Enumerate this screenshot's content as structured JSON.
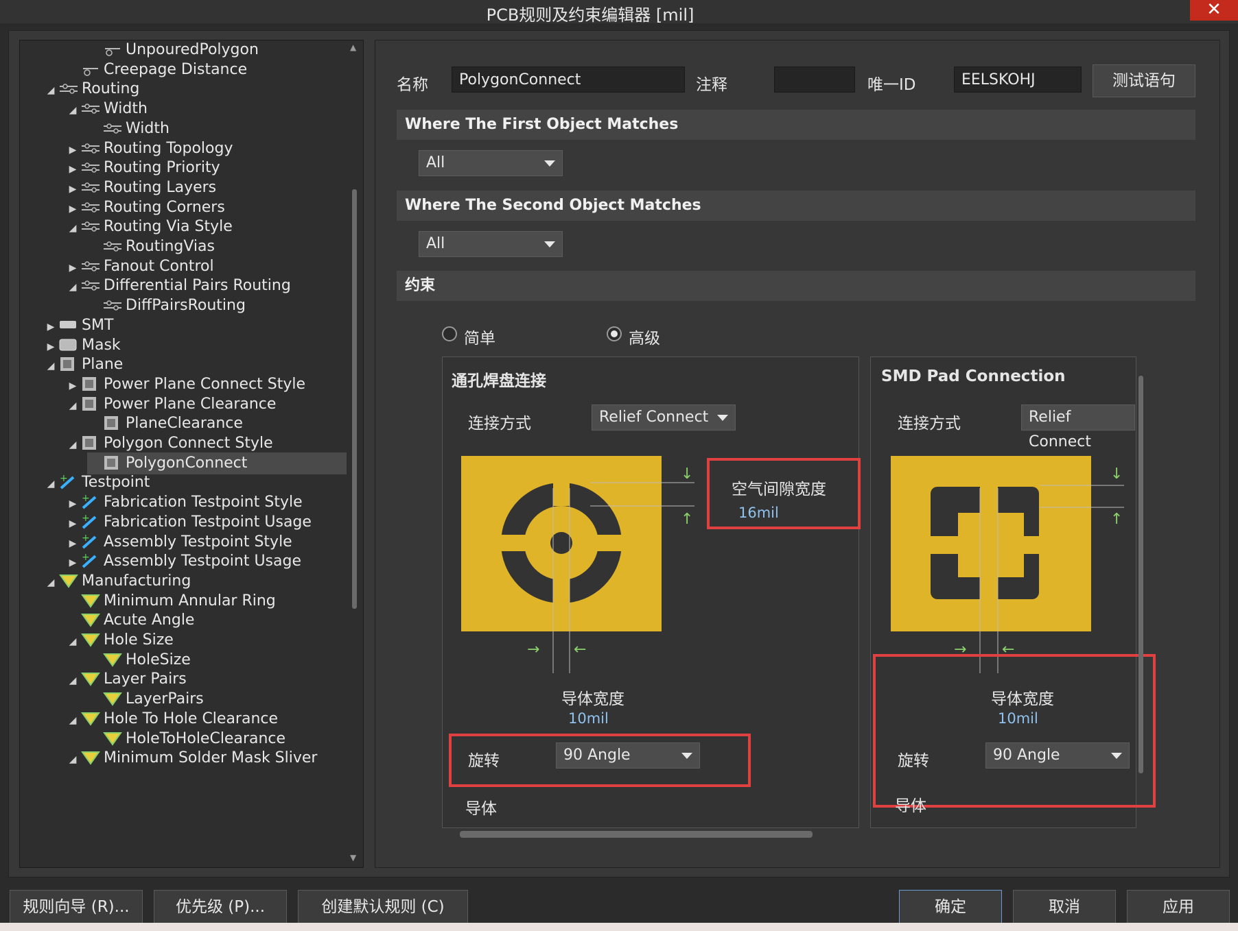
{
  "window": {
    "title": "PCB规则及约束编辑器 [mil]",
    "close_label": "✕"
  },
  "tree": {
    "items": [
      {
        "label": "UnpouredPolygon",
        "expander": ""
      },
      {
        "label": "Creepage Distance",
        "expander": ""
      },
      {
        "label": "Routing",
        "expander": "◢"
      },
      {
        "label": "Width",
        "expander": "◢"
      },
      {
        "label": "Width",
        "expander": ""
      },
      {
        "label": "Routing Topology",
        "expander": "▶"
      },
      {
        "label": "Routing Priority",
        "expander": "▶"
      },
      {
        "label": "Routing Layers",
        "expander": "▶"
      },
      {
        "label": "Routing Corners",
        "expander": "▶"
      },
      {
        "label": "Routing Via Style",
        "expander": "◢"
      },
      {
        "label": "RoutingVias",
        "expander": ""
      },
      {
        "label": "Fanout Control",
        "expander": "▶"
      },
      {
        "label": "Differential Pairs Routing",
        "expander": "◢"
      },
      {
        "label": "DiffPairsRouting",
        "expander": ""
      },
      {
        "label": "SMT",
        "expander": "▶"
      },
      {
        "label": "Mask",
        "expander": "▶"
      },
      {
        "label": "Plane",
        "expander": "◢"
      },
      {
        "label": "Power Plane Connect Style",
        "expander": "▶"
      },
      {
        "label": "Power Plane Clearance",
        "expander": "◢"
      },
      {
        "label": "PlaneClearance",
        "expander": ""
      },
      {
        "label": "Polygon Connect Style",
        "expander": "◢"
      },
      {
        "label": "PolygonConnect",
        "expander": ""
      },
      {
        "label": "Testpoint",
        "expander": "◢"
      },
      {
        "label": "Fabrication Testpoint Style",
        "expander": "▶"
      },
      {
        "label": "Fabrication Testpoint Usage",
        "expander": "▶"
      },
      {
        "label": "Assembly Testpoint Style",
        "expander": "▶"
      },
      {
        "label": "Assembly Testpoint Usage",
        "expander": "▶"
      },
      {
        "label": "Manufacturing",
        "expander": "◢"
      },
      {
        "label": "Minimum Annular Ring",
        "expander": ""
      },
      {
        "label": "Acute Angle",
        "expander": ""
      },
      {
        "label": "Hole Size",
        "expander": "◢"
      },
      {
        "label": "HoleSize",
        "expander": ""
      },
      {
        "label": "Layer Pairs",
        "expander": "◢"
      },
      {
        "label": "LayerPairs",
        "expander": ""
      },
      {
        "label": "Hole To Hole Clearance",
        "expander": "◢"
      },
      {
        "label": "HoleToHoleClearance",
        "expander": ""
      },
      {
        "label": "Minimum Solder Mask Sliver",
        "expander": "◢"
      }
    ]
  },
  "form": {
    "name_label": "名称",
    "name_value": "PolygonConnect",
    "comment_label": "注释",
    "comment_value": "",
    "uid_label": "唯一ID",
    "uid_value": "EELSKOHJ",
    "test_button": "测试语句",
    "first_match_header": "Where The First Object Matches",
    "first_match_value": "All",
    "second_match_header": "Where The Second Object Matches",
    "second_match_value": "All",
    "constraints_header": "约束",
    "radio_simple": "简单",
    "radio_advanced": "高级"
  },
  "through_hole": {
    "title": "通孔焊盘连接",
    "connect_label": "连接方式",
    "connect_value": "Relief Connect",
    "air_gap_label": "空气间隙宽度",
    "air_gap_value": "16mil",
    "conductor_width_label": "导体宽度",
    "conductor_width_value": "10mil",
    "rotation_label": "旋转",
    "rotation_value": "90 Angle",
    "conductors_label": "导体"
  },
  "smd": {
    "title": "SMD Pad Connection",
    "connect_label": "连接方式",
    "connect_value": "Relief Connect",
    "conductor_width_label": "导体宽度",
    "conductor_width_value": "10mil",
    "rotation_label": "旋转",
    "rotation_value": "90 Angle",
    "conductors_label": "导体"
  },
  "bottom": {
    "rule_wizard": "规则向导 (R)...",
    "priority": "优先级 (P)...",
    "create_default": "创建默认规则 (C)",
    "ok": "确定",
    "cancel": "取消",
    "apply": "应用"
  },
  "colors": {
    "copper": "#e0b429",
    "highlight": "#e04040",
    "value": "#8fc2ee"
  }
}
